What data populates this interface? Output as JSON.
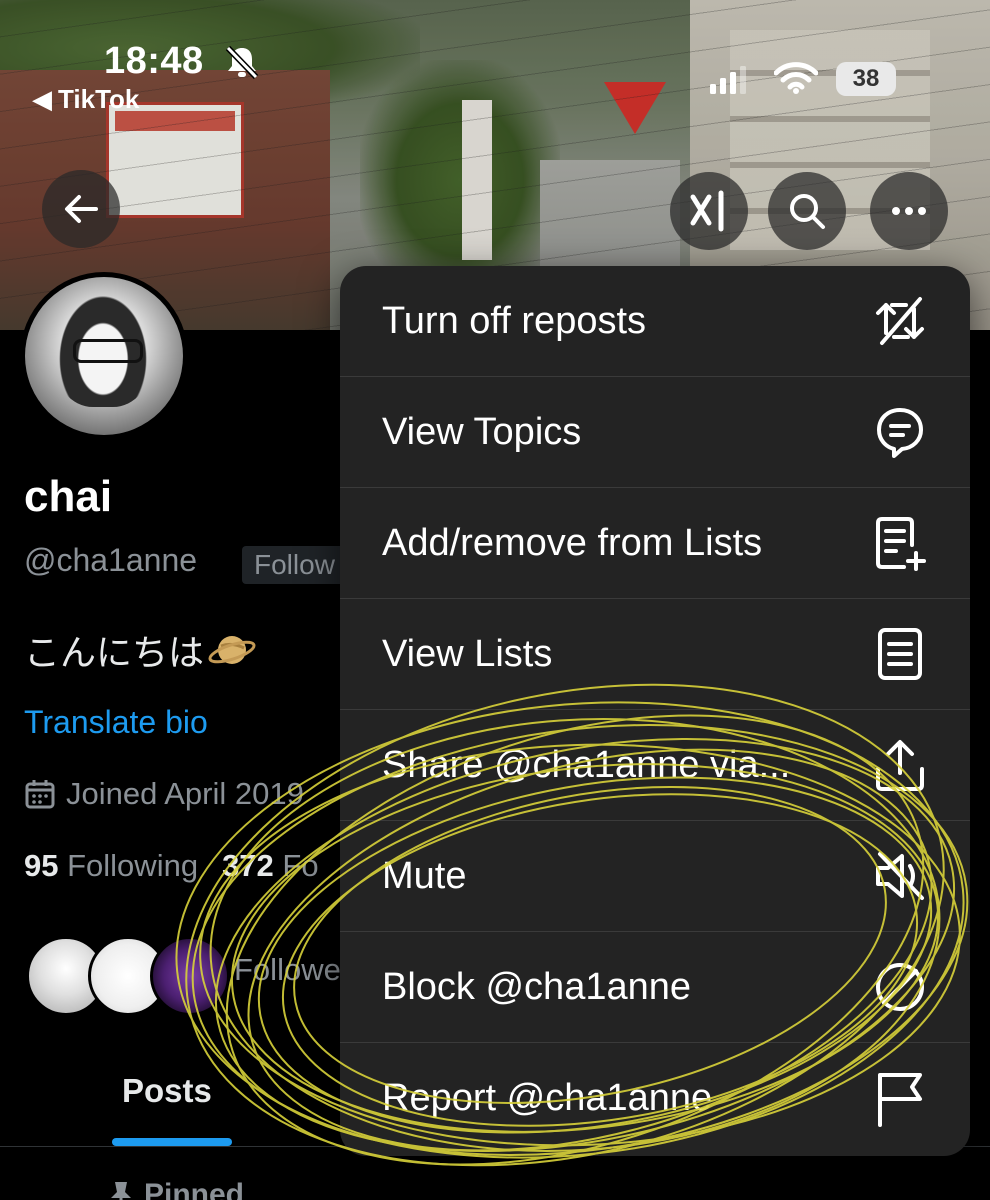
{
  "status_bar": {
    "time": "18:48",
    "back_app": "TikTok",
    "battery": "38"
  },
  "profile": {
    "display_name": "chai",
    "handle": "@cha1anne",
    "follows_badge": "Follow",
    "bio": "こんにちは",
    "translate_bio": "Translate bio",
    "joined": "Joined April 2019",
    "following_count": "95",
    "following_label": "Following",
    "followers_count": "372",
    "followers_label": "Fo",
    "followed_by": "Followe"
  },
  "tabs": {
    "posts": "Posts",
    "pinned": "Pinned"
  },
  "menu": {
    "items": [
      {
        "label": "Turn off reposts",
        "icon": "repost-off-icon"
      },
      {
        "label": "View Topics",
        "icon": "topics-icon"
      },
      {
        "label": "Add/remove from Lists",
        "icon": "list-add-icon"
      },
      {
        "label": "View Lists",
        "icon": "lists-icon"
      },
      {
        "label": "Share @cha1anne via...",
        "icon": "share-icon"
      },
      {
        "label": "Mute",
        "icon": "mute-icon"
      },
      {
        "label": "Block @cha1anne",
        "icon": "block-icon"
      },
      {
        "label": "Report @cha1anne",
        "icon": "flag-icon"
      }
    ]
  },
  "colors": {
    "accent": "#1d9bf0",
    "menu_bg": "#232323",
    "scribble": "#d8d23a"
  }
}
